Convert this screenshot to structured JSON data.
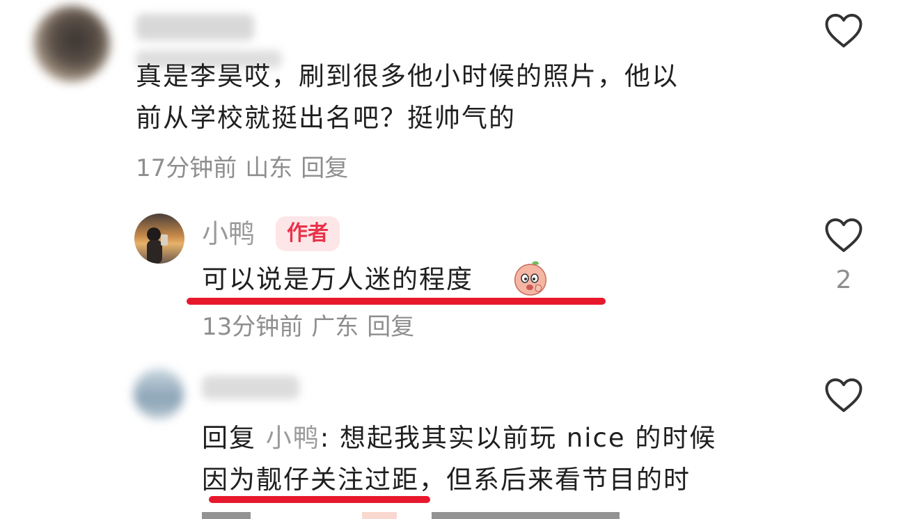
{
  "comments": [
    {
      "text_lines": [
        "真是李昊哎，刷到很多他小时候的照片，他以",
        "前从学校就挺出名吧？挺帅气的"
      ],
      "time": "17分钟前",
      "location": "山东",
      "reply_label": "回复"
    },
    {
      "username": "小鸭",
      "badge": "作者",
      "text": "可以说是万人迷的程度",
      "emoji_icon": "peach-face-emoji-icon",
      "time": "13分钟前",
      "location": "广东",
      "reply_label": "回复",
      "like_count": "2"
    },
    {
      "reply_prefix": "回复",
      "reply_target": "小鸭",
      "reply_text_first": ": 想起我其实以前玩 nice 的时候",
      "text_line2": "因为靓仔关注过距，但系后来看节目的时"
    }
  ],
  "colors": {
    "accent_red": "#e8182c",
    "badge_bg": "#fde6e8",
    "badge_text": "#e8334a",
    "meta_gray": "#8e8e8e"
  },
  "icons": {
    "like": "heart-outline-icon"
  }
}
